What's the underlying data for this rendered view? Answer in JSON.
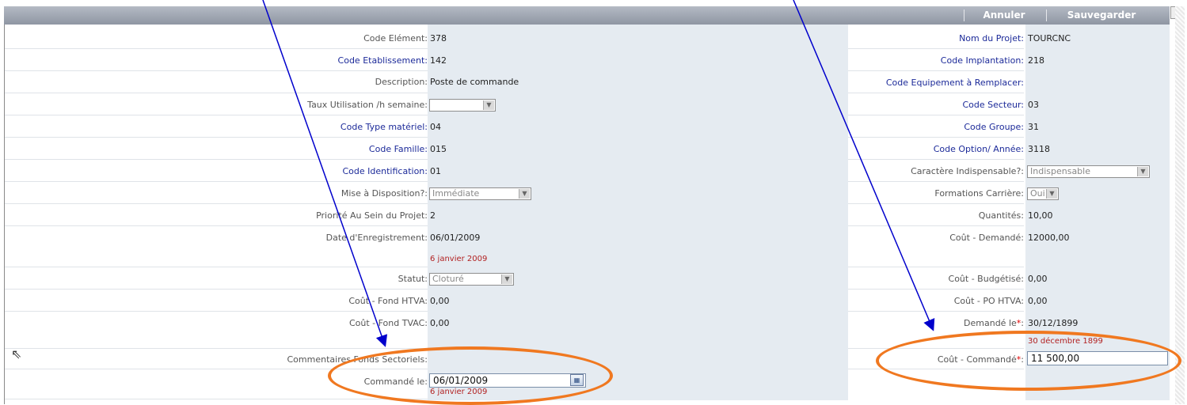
{
  "toolbar": {
    "cancel": "Annuler",
    "save": "Sauvegarder"
  },
  "left": {
    "code_element": {
      "label": "Code Elément:",
      "value": "378"
    },
    "code_etablissement": {
      "label": "Code Etablissement:",
      "value": "142"
    },
    "description": {
      "label": "Description:",
      "value": "Poste de commande"
    },
    "taux": {
      "label": "Taux Utilisation /h semaine:",
      "value": ""
    },
    "code_type": {
      "label": "Code Type matériel:",
      "value": "04"
    },
    "code_famille": {
      "label": "Code Famille:",
      "value": "015"
    },
    "code_identification": {
      "label": "Code Identification:",
      "value": "01"
    },
    "mise_disposition": {
      "label": "Mise à Disposition?:",
      "value": "Immédiate"
    },
    "priorite": {
      "label": "Priorité Au Sein du Projet:",
      "value": "2"
    },
    "date_enreg": {
      "label": "Date d'Enregistrement:",
      "value": "06/01/2009",
      "hint": "6 janvier 2009"
    },
    "statut": {
      "label": "Statut:",
      "value": "Cloturé"
    },
    "cout_fond_htva": {
      "label": "Coût - Fond HTVA:",
      "value": "0,00"
    },
    "cout_fond_tvac": {
      "label": "Coût - Fond TVAC:",
      "value": "0,00"
    },
    "commentaires": {
      "label": "Commentaires Fonds Sectoriels:"
    },
    "commande_le": {
      "label": "Commandé le:",
      "value": "06/01/2009",
      "hint": "6 janvier 2009"
    }
  },
  "right": {
    "nom_projet": {
      "label": "Nom du Projet:",
      "value": "TOURCNC"
    },
    "code_implantation": {
      "label": "Code Implantation:",
      "value": "218"
    },
    "code_equipement": {
      "label": "Code Equipement à Remplacer:"
    },
    "code_secteur": {
      "label": "Code Secteur:",
      "value": "03"
    },
    "code_groupe": {
      "label": "Code Groupe:",
      "value": "31"
    },
    "code_option": {
      "label": "Code Option/ Année:",
      "value": "3118"
    },
    "caractere": {
      "label": "Caractère Indispensable?:",
      "value": "Indispensable"
    },
    "formations": {
      "label": "Formations Carrière:",
      "value": "Oui"
    },
    "quantites": {
      "label": "Quantités:",
      "value": "10,00"
    },
    "cout_demande": {
      "label": "Coût - Demandé:",
      "value": "12000,00"
    },
    "cout_budgetise": {
      "label": "Coût - Budgétisé:",
      "value": "0,00"
    },
    "cout_po_htva": {
      "label": "Coût - PO HTVA:",
      "value": "0,00"
    },
    "demande_le": {
      "label": "Demandé le",
      "req": "*",
      "colon": ":",
      "value": "30/12/1899",
      "hint": "30 décembre 1899"
    },
    "cout_commande": {
      "label": "Coût - Commandé",
      "req": "*",
      "colon": ":",
      "value": "11 500,00"
    }
  },
  "colors": {
    "annotation_ellipse": "#f07820",
    "annotation_arrow": "#0000cc",
    "panel": "#e5ebf1"
  }
}
